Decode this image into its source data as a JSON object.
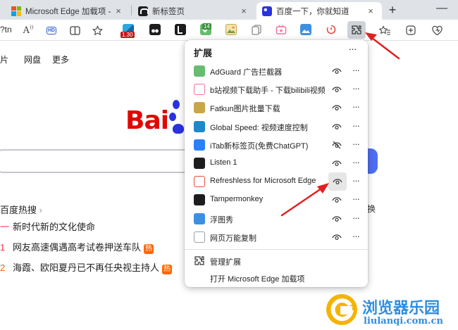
{
  "tabs": [
    {
      "title": "Microsoft Edge 加载项 - Refreshless",
      "close": "×",
      "icon": "microsoft-logo-icon"
    },
    {
      "title": "新标签页",
      "close": "×",
      "icon": "itab-icon"
    },
    {
      "title": "百度一下，你就知道",
      "close": "×",
      "icon": "baidu-paw-icon"
    }
  ],
  "new_tab_label": "+",
  "window_minimize": "—",
  "toolbar": {
    "url_fragment": "?tn",
    "read_aloud": "A",
    "hd_badge": "HD",
    "global_speed_badge": "1.30",
    "adguard_badge": "14"
  },
  "page": {
    "nav": [
      "图片",
      "网盘",
      "更多"
    ],
    "logo_text": "Bai",
    "hot_title": "百度热搜",
    "hot_list": [
      {
        "rank": "\u0000",
        "text": "新时代新的文化使命",
        "badge": ""
      },
      {
        "rank": "1",
        "text": "网友高速偶遇高考试卷押送车队",
        "badge": "热"
      },
      {
        "rank": "2",
        "text": "海霞、欧阳夏丹已不再任央视主持人",
        "badge": "热"
      }
    ],
    "refresh_fragment": "换"
  },
  "extensions_panel": {
    "title": "扩展",
    "more": "···",
    "items": [
      {
        "name": "AdGuard 广告拦截器",
        "icon": "adguard-icon",
        "color": "#68bc71",
        "pinned": true
      },
      {
        "name": "b站视频下载助手 - 下载bilibili视频",
        "icon": "bilibili-download-icon",
        "color": "#f5719a",
        "pinned": true
      },
      {
        "name": "Fatkun图片批量下载",
        "icon": "fatkun-icon",
        "color": "#c8a64a",
        "pinned": true
      },
      {
        "name": "Global Speed: 视频速度控制",
        "icon": "global-speed-icon",
        "color": "#1e88c8",
        "pinned": true
      },
      {
        "name": "iTab新标签页(免费ChatGPT)",
        "icon": "itab-icon",
        "color": "#2d7ff9",
        "pinned": false
      },
      {
        "name": "Listen 1",
        "icon": "listen1-icon",
        "color": "#1d1d1f",
        "pinned": true
      },
      {
        "name": "Refreshless for Microsoft Edge",
        "icon": "refreshless-icon",
        "color": "#e74c3c",
        "pinned": true
      },
      {
        "name": "Tampermonkey",
        "icon": "tampermonkey-icon",
        "color": "#1d1d1f",
        "pinned": true
      },
      {
        "name": "浮图秀",
        "icon": "futuxiu-icon",
        "color": "#3d8fe0",
        "pinned": true
      },
      {
        "name": "网页万能复制",
        "icon": "copy-icon",
        "color": "#9aa0a6",
        "pinned": true
      }
    ],
    "manage_label": "管理扩展",
    "open_addons_label": "打开 Microsoft Edge 加载项"
  },
  "watermark": {
    "name": "浏览器乐园",
    "url": "liulanqi.com.cn"
  },
  "accent_colors": {
    "arrow": "#e02020",
    "baidu_blue": "#2932e1",
    "baidu_red": "#e10601",
    "hot_orange": "#ff6600"
  }
}
